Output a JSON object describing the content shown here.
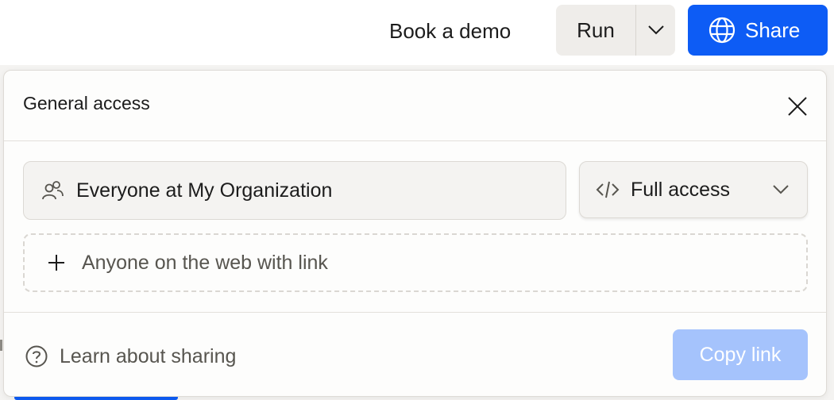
{
  "toolbar": {
    "book_demo_label": "Book a demo",
    "run_label": "Run",
    "share_label": "Share",
    "share_color": "#0d5cf5"
  },
  "share_panel": {
    "title": "General access",
    "members_label": "Everyone at My Organization",
    "access_level": "Full access",
    "add_web_label": "Anyone on the web with link",
    "learn_label": "Learn about sharing",
    "copy_label": "Copy link",
    "copy_button_color": "#a5c3fc"
  },
  "icons": {
    "share": "globe-icon",
    "run_dropdown": "chevron-down-icon",
    "close": "close-icon",
    "members": "users-icon",
    "access": "code-icon",
    "access_dropdown": "chevron-down-icon",
    "add": "plus-icon",
    "help": "question-circle-icon"
  }
}
